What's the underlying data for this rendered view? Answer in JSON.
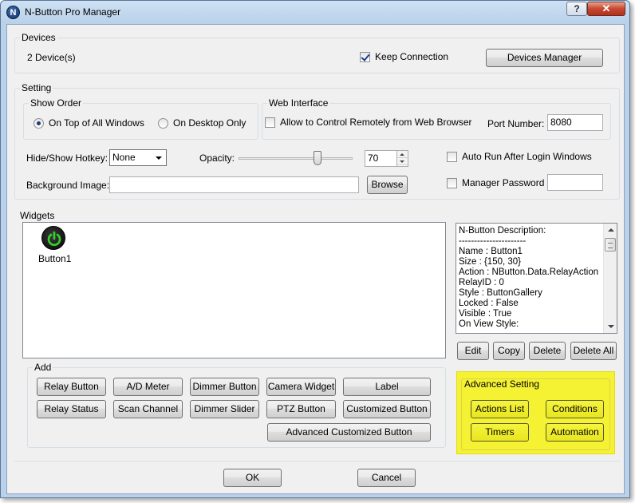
{
  "window": {
    "title": "N-Button Pro Manager",
    "icon_letter": "N",
    "help_label": "?",
    "close_label": "✕"
  },
  "devices": {
    "group_label": "Devices",
    "count_text": "2 Device(s)",
    "keep_connection_label": "Keep Connection",
    "keep_connection_checked": true,
    "manager_button": "Devices Manager"
  },
  "setting": {
    "group_label": "Setting",
    "show_order": {
      "group_label": "Show Order",
      "options": [
        "On Top of All Windows",
        "On Desktop Only"
      ],
      "selected": "On Top of All Windows"
    },
    "web_interface": {
      "group_label": "Web Interface",
      "allow_label": "Allow to Control Remotely from Web Browser",
      "allow_checked": false,
      "port_label": "Port Number:",
      "port_value": "8080"
    },
    "hotkey_label": "Hide/Show Hotkey:",
    "hotkey_value": "None",
    "opacity_label": "Opacity:",
    "opacity_value": "70",
    "auto_run_label": "Auto Run After Login Windows",
    "auto_run_checked": false,
    "background_label": "Background Image:",
    "background_value": "",
    "browse_button": "Browse",
    "manager_password_label": "Manager Password",
    "manager_password_checked": false,
    "manager_password_value": ""
  },
  "widgets": {
    "group_label": "Widgets",
    "items": [
      {
        "label": "Button1",
        "icon": "power-icon"
      }
    ],
    "description_lines": [
      "N-Button Description:",
      "----------------------",
      "Name : Button1",
      "Size : {150, 30}",
      "Action : NButton.Data.RelayAction",
      "RelayID : 0",
      "Style : ButtonGallery",
      "Locked : False",
      "Visible : True",
      "On View Style:"
    ],
    "edit_button": "Edit",
    "copy_button": "Copy",
    "delete_button": "Delete",
    "delete_all_button": "Delete All"
  },
  "add": {
    "group_label": "Add",
    "row1": [
      "Relay Button",
      "A/D Meter",
      "Dimmer Button",
      "Camera Widget",
      "Label"
    ],
    "row2": [
      "Relay Status",
      "Scan Channel",
      "Dimmer Slider",
      "PTZ Button",
      "Customized Button"
    ],
    "advanced_customized": "Advanced Customized Button"
  },
  "advanced": {
    "group_label": "Advanced Setting",
    "actions_list": "Actions List",
    "conditions": "Conditions",
    "timers": "Timers",
    "automation": "Automation",
    "highlight_color": "#f5f234"
  },
  "footer": {
    "ok": "OK",
    "cancel": "Cancel"
  }
}
